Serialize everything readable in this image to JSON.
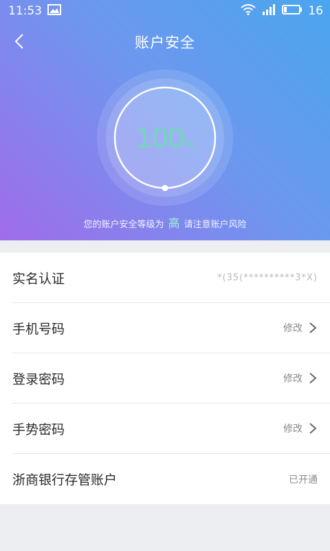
{
  "status_bar": {
    "time": "11:53",
    "battery_level": "16",
    "icons": [
      "image-icon",
      "wifi-icon",
      "signal-icon",
      "battery-icon"
    ]
  },
  "header": {
    "title": "账户安全",
    "back_icon": "back-arrow-icon"
  },
  "security": {
    "score": "100",
    "unit": "%",
    "progress": 1.0,
    "level_prefix": "您的账户安全等级为",
    "level": "高",
    "level_suffix": "请注意账户风险"
  },
  "items": [
    {
      "label": "实名认证",
      "value": "*(35(**********3*X)",
      "chevron": false
    },
    {
      "label": "手机号码",
      "value": "修改",
      "chevron": true
    },
    {
      "label": "登录密码",
      "value": "修改",
      "chevron": true
    },
    {
      "label": "手势密码",
      "value": "修改",
      "chevron": true
    },
    {
      "label": "浙商银行存管账户",
      "value": "已开通",
      "chevron": false
    }
  ],
  "colors": {
    "gradient_start": "#4aa6ee",
    "gradient_end": "#a06cea",
    "score_color": "#6fd8b8"
  }
}
